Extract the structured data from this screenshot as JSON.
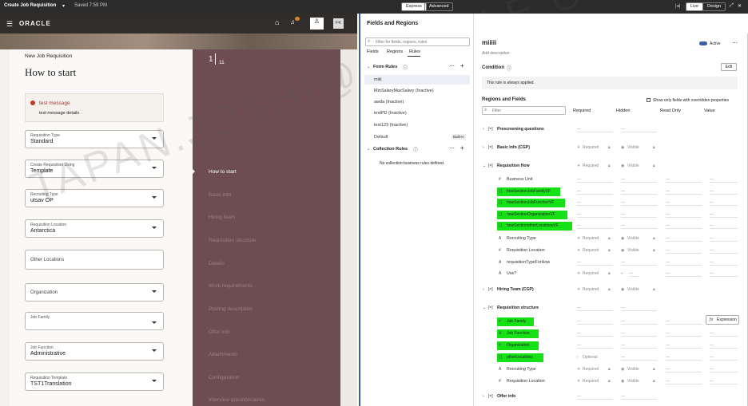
{
  "topbar": {
    "title": "Create Job Requisition",
    "saved": "Saved 7:59 PM",
    "express": "Express",
    "advanced": "Advanced",
    "live": "Live",
    "design": "Design"
  },
  "oracle": {
    "logo": "ORACLE",
    "avatar": "FK"
  },
  "left": {
    "subtitle": "New Job Requisition",
    "title": "How to start",
    "message_title": "test message",
    "message_body": "test message details",
    "fields": [
      {
        "label": "Requisition Type",
        "value": "Standard"
      },
      {
        "label": "Create Requisition Using",
        "value": "Template"
      },
      {
        "label": "Recruiting Type",
        "value": "utsav OP"
      },
      {
        "label": "Requisition Location",
        "value": "Antarctica"
      },
      {
        "label": "",
        "value": "Other Locations"
      },
      {
        "label": "",
        "value": "Organization"
      },
      {
        "label": "Job Family",
        "value": ""
      },
      {
        "label": "Job Function",
        "value": "Administrative"
      },
      {
        "label": "Requisition Template",
        "value": "TST1Translation"
      }
    ],
    "pager": {
      "current": "1",
      "total": "11"
    },
    "steps": [
      "How to start",
      "Basic info",
      "Hiring team",
      "Requisition structure",
      "Details",
      "Work requirements",
      "Posting description",
      "Offer info",
      "Attachments",
      "Configuration",
      "Interview questionnaires"
    ],
    "watermark": "TAPAN.JOSHI@ORACLE.COM"
  },
  "fr": {
    "title": "Fields and Regions",
    "search_placeholder": "Filter for fields, regions, rules",
    "tabs": [
      "Fields",
      "Regions",
      "Rules"
    ],
    "form_rules_title": "Form Rules",
    "rules": [
      "miiii",
      "MinSalaryMaxSalary (Inactive)",
      "awda (Inactive)",
      "testPD (Inactive)",
      "test123 (Inactive)",
      "Default"
    ],
    "builtin": "Built-in",
    "collection_title": "Collection Rules",
    "collection_empty": "No collection business rules defined."
  },
  "editor": {
    "name": "miiiii",
    "active": "Active",
    "add_description": "Add description",
    "condition_title": "Condition",
    "edit": "Edit",
    "always_applied": "This rule is always applied.",
    "regions_title": "Regions and Fields",
    "overridden_label": "Show only fields with overridden properties",
    "filter_placeholder": "Filter",
    "columns": [
      "Required",
      "Hidden",
      "Read Only",
      "Value"
    ],
    "required": "Required",
    "visible": "Visible",
    "optional": "Optional",
    "expression": "Expression",
    "rows": [
      {
        "kind": "region",
        "name": "Prescreening questions"
      },
      {
        "kind": "region",
        "name": "Basic Info (CGP)"
      },
      {
        "kind": "region",
        "name": "Requisition How"
      },
      {
        "kind": "field",
        "icon": "#",
        "name": "Business Unit"
      },
      {
        "kind": "hl",
        "icon": "[ ]",
        "name": "howSectionJobFamilyVF"
      },
      {
        "kind": "hl",
        "icon": "[ ]",
        "name": "howSectionJobFunctionVF"
      },
      {
        "kind": "hl",
        "icon": "[ ]",
        "name": "howSectionOrganizationVF"
      },
      {
        "kind": "hl",
        "icon": "[ ]",
        "name": "howSectionotherLocationsVF"
      },
      {
        "kind": "field",
        "icon": "A",
        "name": "Recruiting Type"
      },
      {
        "kind": "field",
        "icon": "#",
        "name": "Requisition Location"
      },
      {
        "kind": "field",
        "icon": "A",
        "name": "requisitionTypeForHow"
      },
      {
        "kind": "field",
        "icon": "A",
        "name": "Use?"
      },
      {
        "kind": "region",
        "name": "Hiring Team (CGP)"
      },
      {
        "kind": "region",
        "name": "Requisition structure"
      },
      {
        "kind": "hl",
        "icon": "#",
        "name": "Job Family"
      },
      {
        "kind": "hl",
        "icon": "A",
        "name": "Job Function"
      },
      {
        "kind": "hl",
        "icon": "#",
        "name": "Organization"
      },
      {
        "kind": "hl",
        "icon": "[ ]",
        "name": "otherLocations"
      },
      {
        "kind": "field",
        "icon": "A",
        "name": "Recruiting Type"
      },
      {
        "kind": "field",
        "icon": "#",
        "name": "Requisition Location"
      },
      {
        "kind": "region",
        "name": "Offer info"
      }
    ]
  }
}
